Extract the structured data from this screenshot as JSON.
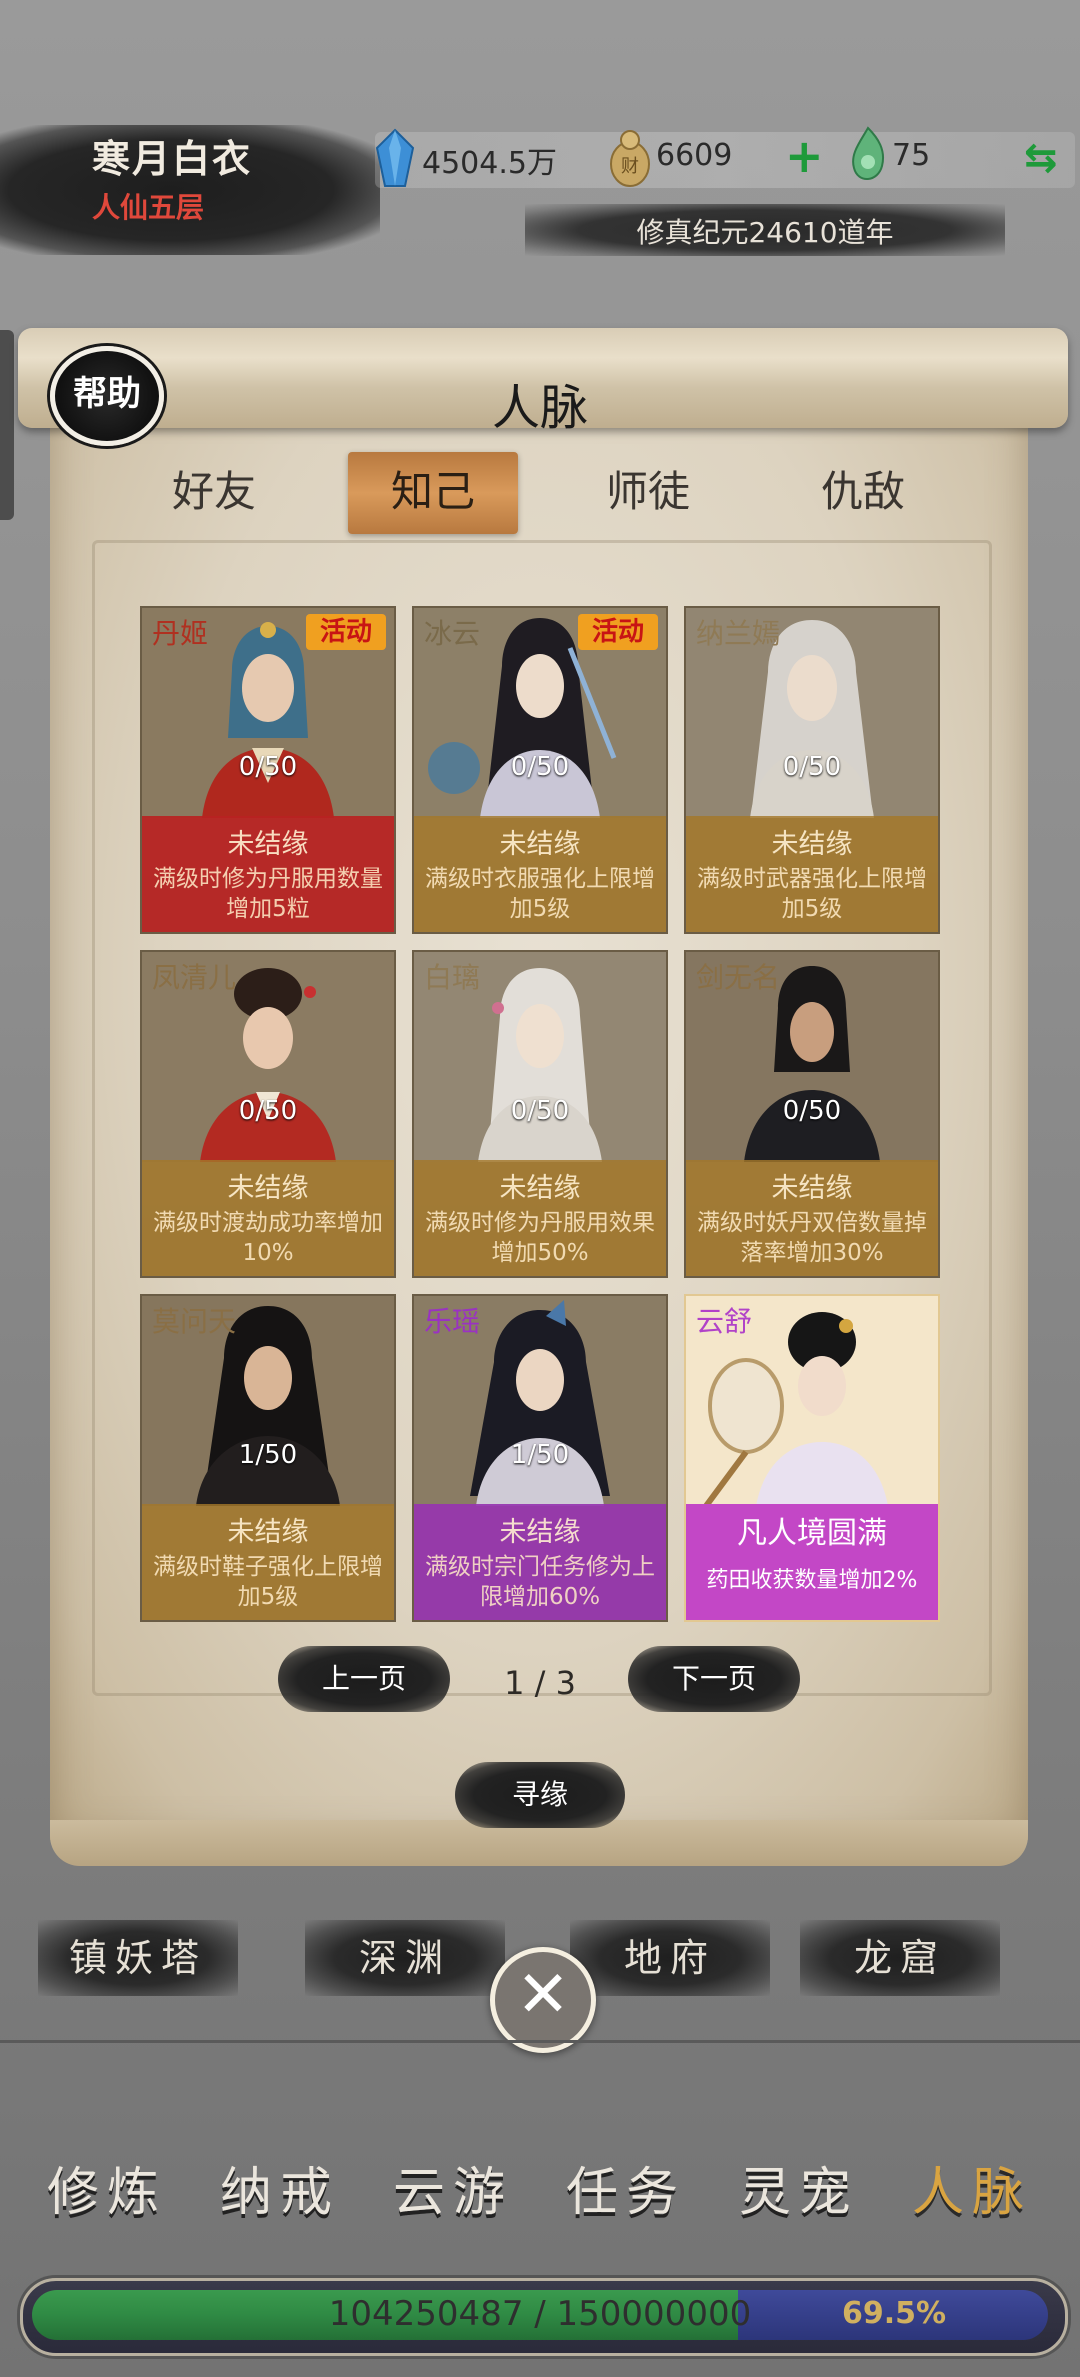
{
  "player": {
    "name": "寒月白衣",
    "rank": "人仙五层"
  },
  "resources": {
    "spirit_stones": "4504.5万",
    "gold": "6609",
    "jade": "75"
  },
  "era": "修真纪元24610道年",
  "panel": {
    "title": "人脉",
    "help_label": "帮助"
  },
  "tabs": [
    {
      "label": "好友",
      "active": false
    },
    {
      "label": "知己",
      "active": true
    },
    {
      "label": "师徒",
      "active": false
    },
    {
      "label": "仇敌",
      "active": false
    }
  ],
  "cards": [
    {
      "name": "丹姬",
      "tag": "活动",
      "progress": "0/50",
      "status": "未结缘",
      "desc": "满级时修为丹服用数量增加5粒"
    },
    {
      "name": "冰云",
      "tag": "活动",
      "progress": "0/50",
      "status": "未结缘",
      "desc": "满级时衣服强化上限增加5级"
    },
    {
      "name": "纳兰嫣",
      "progress": "0/50",
      "status": "未结缘",
      "desc": "满级时武器强化上限增加5级"
    },
    {
      "name": "凤清儿",
      "progress": "0/50",
      "status": "未结缘",
      "desc": "满级时渡劫成功率增加10%"
    },
    {
      "name": "白璃",
      "progress": "0/50",
      "status": "未结缘",
      "desc": "满级时修为丹服用效果增加50%"
    },
    {
      "name": "剑无名",
      "progress": "0/50",
      "status": "未结缘",
      "desc": "满级时妖丹双倍数量掉落率增加30%"
    },
    {
      "name": "莫问天",
      "progress": "1/50",
      "status": "未结缘",
      "desc": "满级时鞋子强化上限增加5级"
    },
    {
      "name": "乐瑶",
      "progress": "1/50",
      "status": "未结缘",
      "desc": "满级时宗门任务修为上限增加60%"
    },
    {
      "name": "云舒",
      "progress": "",
      "status": "凡人境圆满",
      "desc": "药田收获数量增加2%"
    }
  ],
  "pagination": {
    "prev": "上一页",
    "next": "下一页",
    "indicator": "1 / 3"
  },
  "seek_button": "寻缘",
  "sub_nav": [
    "镇妖塔",
    "深渊",
    "地府",
    "龙窟"
  ],
  "main_nav": [
    {
      "label": "修炼",
      "active": false
    },
    {
      "label": "纳戒",
      "active": false
    },
    {
      "label": "云游",
      "active": false
    },
    {
      "label": "任务",
      "active": false
    },
    {
      "label": "灵宠",
      "active": false
    },
    {
      "label": "人脉",
      "active": true
    }
  ],
  "experience": {
    "text": "104250487 / 150000000",
    "percent": "69.5%",
    "fraction": 0.695
  },
  "icons": {
    "close": "close-icon",
    "plus": "plus-icon",
    "swap": "swap-icon"
  },
  "colors": {
    "accent_gold": "#d9a441",
    "tab_active": "#c88a4c",
    "xp_green": "#2f8a44",
    "card_red": "#b82222",
    "card_purple": "#9634af"
  }
}
